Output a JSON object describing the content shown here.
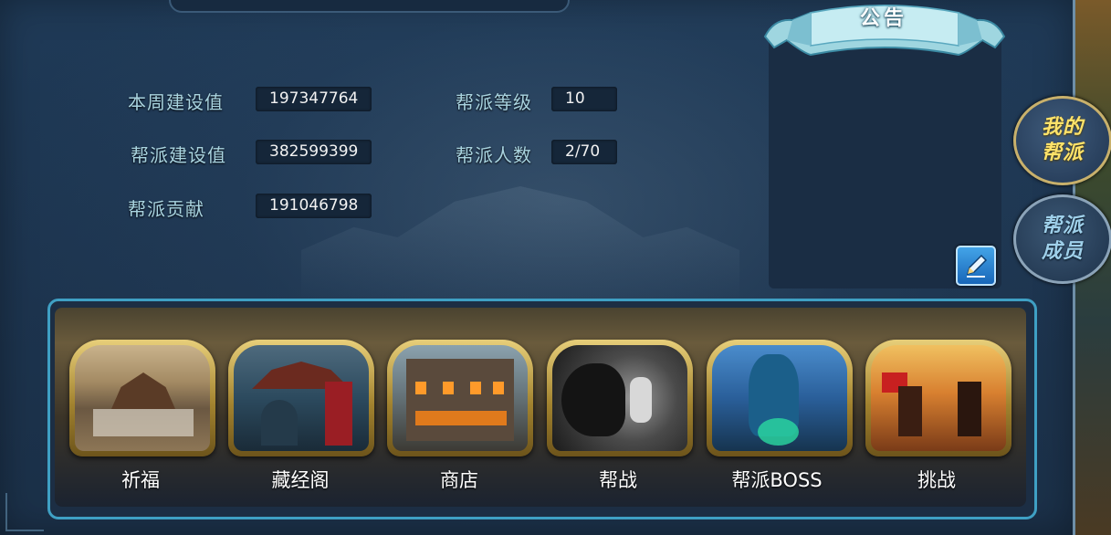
{
  "stats": {
    "weekly_build_label": "本周建设值",
    "weekly_build_value": "197347764",
    "guild_build_label": "帮派建设值",
    "guild_build_value": "382599399",
    "guild_contrib_label": "帮派贡献",
    "guild_contrib_value": "191046798",
    "guild_level_label": "帮派等级",
    "guild_level_value": "10",
    "guild_members_label": "帮派人数",
    "guild_members_value": "2/70"
  },
  "notice": {
    "title": "公告",
    "edit_icon": "pencil-icon"
  },
  "side_tabs": [
    {
      "label_line1": "我的",
      "label_line2": "帮派",
      "active": true
    },
    {
      "label_line1": "帮派",
      "label_line2": "成员",
      "active": false
    }
  ],
  "features": [
    {
      "label": "祈福"
    },
    {
      "label": "藏经阁"
    },
    {
      "label": "商店"
    },
    {
      "label": "帮战"
    },
    {
      "label": "帮派BOSS"
    },
    {
      "label": "挑战"
    }
  ],
  "colors": {
    "panel_bg": "#1d3550",
    "label_text": "#a9d4e0",
    "active_tab_text": "#ffe36a",
    "frame_accent": "#3fa0c4",
    "card_gold": "#c9a84a"
  }
}
